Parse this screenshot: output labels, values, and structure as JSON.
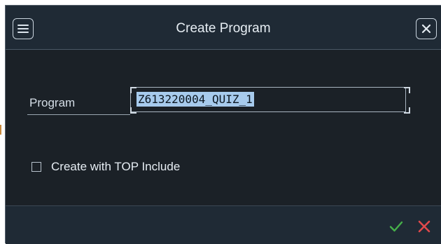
{
  "dialog": {
    "title": "Create Program",
    "menu_icon": "hamburger-menu-icon",
    "close_icon": "close-icon"
  },
  "form": {
    "program_label": "Program",
    "program_value": "Z613220004_QUIZ_1",
    "top_include_label": "Create with TOP Include",
    "top_include_checked": false
  },
  "footer": {
    "confirm_icon": "checkmark-icon",
    "cancel_icon": "cancel-x-icon"
  },
  "colors": {
    "background": "#1b2127",
    "bar": "#1f2a35",
    "selection": "#a7cbed",
    "confirm": "#46b04a",
    "cancel": "#e0494b"
  }
}
